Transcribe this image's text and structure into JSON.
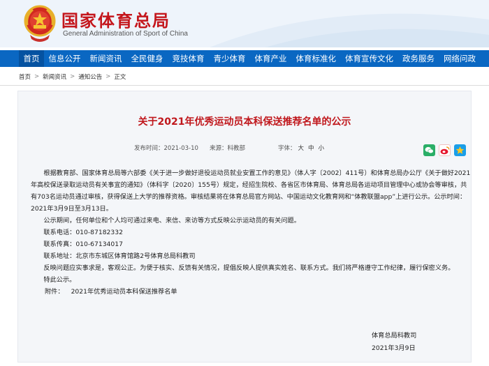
{
  "header": {
    "title": "国家体育总局",
    "subtitle": "General Administration of Sport of China"
  },
  "nav": [
    {
      "label": "首页",
      "active": true
    },
    {
      "label": "信息公开"
    },
    {
      "label": "新闻资讯"
    },
    {
      "label": "全民健身"
    },
    {
      "label": "竞技体育"
    },
    {
      "label": "青少体育"
    },
    {
      "label": "体育产业"
    },
    {
      "label": "体育标准化"
    },
    {
      "label": "体育宣传文化"
    },
    {
      "label": "政务服务"
    },
    {
      "label": "网络问政"
    }
  ],
  "breadcrumb": [
    "首页",
    "新闻资讯",
    "通知公告",
    "正文"
  ],
  "breadcrumb_sep": ">",
  "article": {
    "title": "关于2021年优秀运动员本科保送推荐名单的公示",
    "meta": {
      "date": "发布时间：2021-03-10",
      "source": "来源：科教部",
      "font_label": "字体：",
      "font_sizes": [
        "大",
        "中",
        "小"
      ]
    },
    "paragraphs": {
      "p1": "根据教育部、国家体育总局等六部委《关于进一步做好退役运动员就业安置工作的意见》（体人字〔2002〕411号）和体育总局办公厅《关于做好2021年高校保送录取运动员有关事宜的通知》（体科字〔2020〕155号）规定，经招生院校、各省区市体育局、体育总局各运动项目管理中心或协会等审核，共有703名运动员通过审核，获得保送上大学的推荐资格。审核结果将在体育总局官方网站、中国运动文化教育网和“体教联盟app”上进行公示。公示时间：2021年3月9日至3月13日。",
      "p2": "公示期间，任何单位和个人均可通过来电、来信、来访等方式反映公示运动员的有关问题。",
      "phone": "联系电话：010-87182332",
      "fax": "联系传真：010-67134017",
      "address": "联系地址：北京市东城区体育馆路2号体育总局科教司",
      "p3": "反映问题应实事求是，客观公正。为便于核实、反馈有关情况，提倡反映人提供真实姓名、联系方式。我们将严格遵守工作纪律，履行保密义务。",
      "p4": "特此公示。",
      "attach_label": "附件：",
      "attach_link": "2021年优秀运动员本科保送推荐名单"
    },
    "signature": {
      "org": "体育总局科教司",
      "date": "2021年3月9日"
    }
  },
  "share": [
    {
      "icon": "wechat-icon",
      "color": "#2aae67"
    },
    {
      "icon": "weibo-icon",
      "color": "#e6162d"
    },
    {
      "icon": "qzone-icon",
      "color": "#f4b400"
    }
  ]
}
